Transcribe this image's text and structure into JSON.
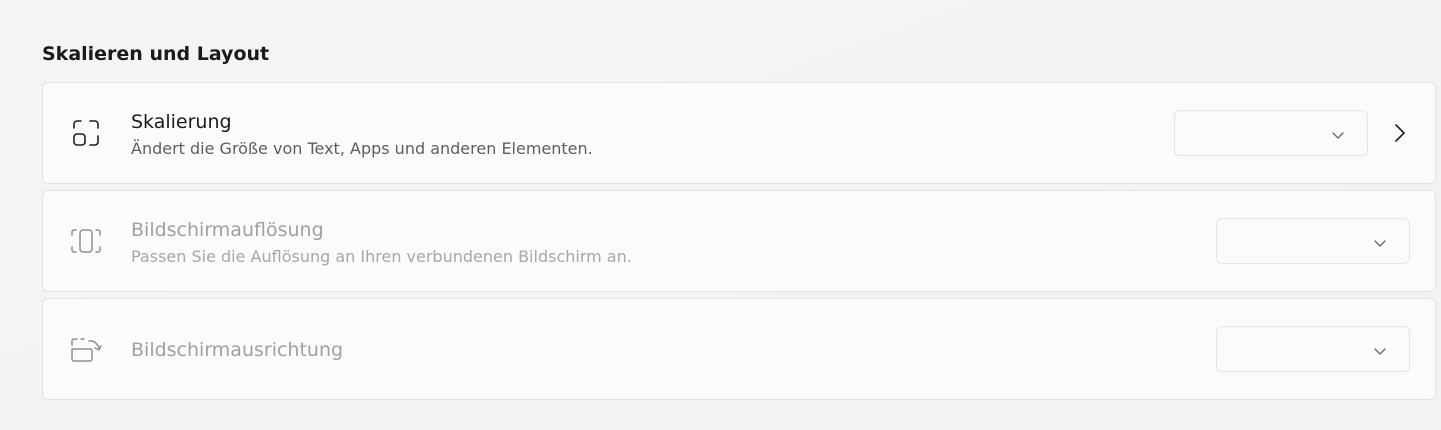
{
  "section": {
    "title": "Skalieren und Layout"
  },
  "cards": [
    {
      "title": "Skalierung",
      "description": "Ändert die Größe von Text, Apps und anderen Elementen.",
      "icon": "scale-icon",
      "enabled": true,
      "dropdown_value": ""
    },
    {
      "title": "Bildschirmauflösung",
      "description": "Passen Sie die Auflösung an Ihren verbundenen Bildschirm an.",
      "icon": "resolution-icon",
      "enabled": false,
      "dropdown_value": ""
    },
    {
      "title": "Bildschirmausrichtung",
      "icon": "orientation-icon",
      "enabled": false,
      "dropdown_value": ""
    }
  ],
  "colors": {
    "text_primary": "#1b1b1b",
    "text_secondary": "#5e5e5e",
    "text_disabled": "#a0a0a0",
    "card_background": "#fbfbfb",
    "card_border": "#e3e3e3"
  }
}
